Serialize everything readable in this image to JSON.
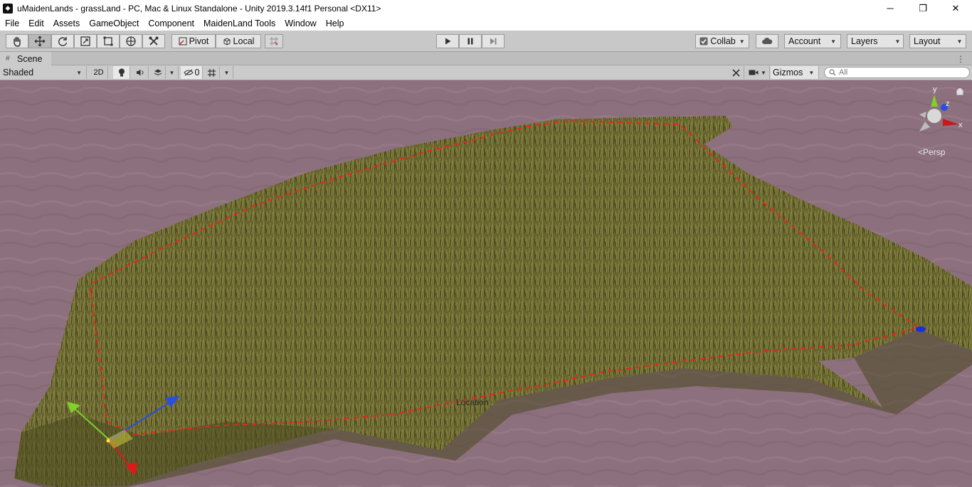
{
  "window": {
    "title": "uMaidenLands - grassLand - PC, Mac & Linux Standalone - Unity 2019.3.14f1 Personal <DX11>",
    "minimize_glyph": "─",
    "maximize_glyph": "❐",
    "close_glyph": "✕"
  },
  "menu": [
    "File",
    "Edit",
    "Assets",
    "GameObject",
    "Component",
    "MaidenLand Tools",
    "Window",
    "Help"
  ],
  "toolbar": {
    "pivot_label": "Pivot",
    "local_label": "Local",
    "collab_label": "Collab",
    "account_label": "Account",
    "layers_label": "Layers",
    "layout_label": "Layout",
    "active_tool": "move-tool"
  },
  "scene_tab": {
    "label": "Scene"
  },
  "scene_bar": {
    "draw_mode": "Shaded",
    "mode_2d": "2D",
    "hidden_count": "0",
    "gizmos_label": "Gizmos",
    "search_placeholder": "All"
  },
  "viewport": {
    "location_label": "Location",
    "projection_label": "Persp",
    "gizmo_axes": {
      "y": "y",
      "z": "z",
      "x": "x"
    },
    "colors": {
      "ground": "#8c6f7d",
      "grass": "#6b6a2e",
      "selection_outline": "#e02a1a",
      "axis_x": "#e01818",
      "axis_y": "#7fd02a",
      "axis_z": "#2a4fe0"
    }
  }
}
